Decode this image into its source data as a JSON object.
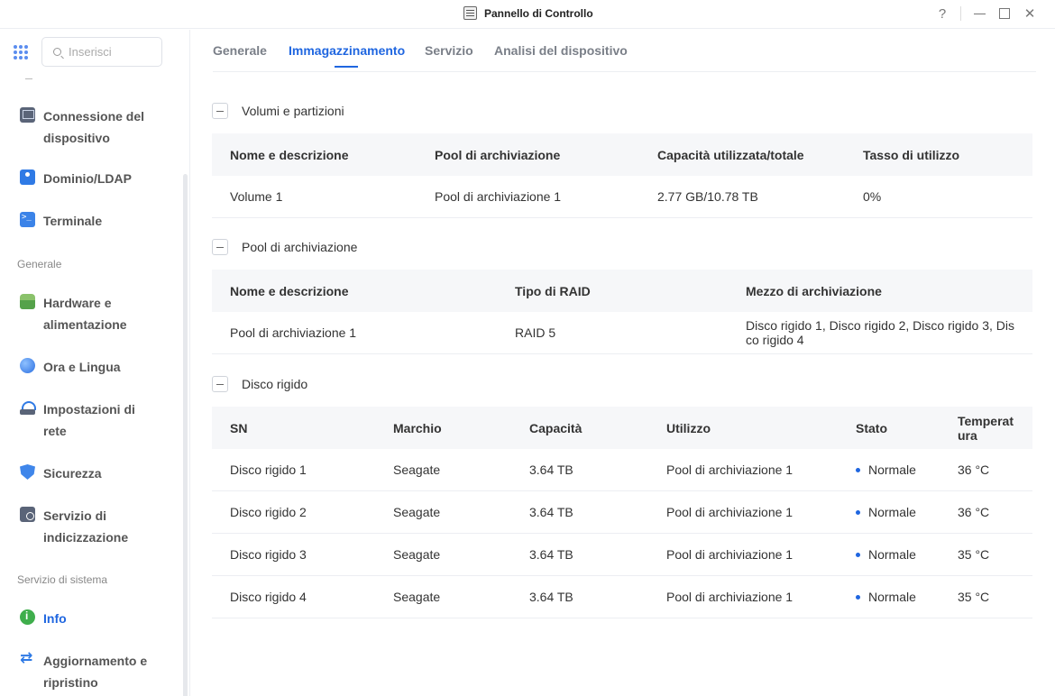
{
  "window": {
    "title": "Pannello di Controllo",
    "help": "?",
    "close": "✕"
  },
  "colors": {
    "accent": "#1f66e0",
    "status_ok": "#1f66e0"
  },
  "sidebar": {
    "search_placeholder": "Inserisci",
    "items": [
      {
        "label": "Connessione del dispositivo",
        "icon": "device-connection-icon"
      },
      {
        "label": "Dominio/LDAP",
        "icon": "domain-ldap-icon"
      },
      {
        "label": "Terminale",
        "icon": "terminal-icon"
      },
      {
        "label": "Hardware e alimentazione",
        "icon": "hardware-power-icon"
      },
      {
        "label": "Ora e Lingua",
        "icon": "time-language-icon"
      },
      {
        "label": "Impostazioni di rete",
        "icon": "network-icon"
      },
      {
        "label": "Sicurezza",
        "icon": "security-shield-icon"
      },
      {
        "label": "Servizio di indicizzazione",
        "icon": "indexing-icon"
      },
      {
        "label": "Info",
        "icon": "info-icon",
        "active": true
      },
      {
        "label": "Aggiornamento e ripristino",
        "icon": "update-restore-icon"
      }
    ],
    "sections": {
      "general": "Generale",
      "system": "Servizio di sistema"
    }
  },
  "tabs": [
    {
      "label": "Generale"
    },
    {
      "label": "Immagazzinamento",
      "active": true
    },
    {
      "label": "Servizio"
    },
    {
      "label": "Analisi del dispositivo"
    }
  ],
  "volumes": {
    "title": "Volumi e partizioni",
    "headers": [
      "Nome e descrizione",
      "Pool di archiviazione",
      "Capacità utilizzata/totale",
      "Tasso di utilizzo"
    ],
    "rows": [
      [
        "Volume 1",
        "Pool di archiviazione 1",
        "2.77 GB/10.78 TB",
        "0%"
      ]
    ]
  },
  "pools": {
    "title": "Pool di archiviazione",
    "headers": [
      "Nome e descrizione",
      "Tipo di RAID",
      "Mezzo di archiviazione"
    ],
    "rows": [
      [
        "Pool di archiviazione 1",
        "RAID 5",
        "Disco rigido 1, Disco rigido 2, Disco rigido 3, Dis co rigido 4"
      ]
    ]
  },
  "disks": {
    "title": "Disco rigido",
    "headers": [
      "SN",
      "Marchio",
      "Capacità",
      "Utilizzo",
      "Stato",
      "Temperat ura"
    ],
    "rows": [
      [
        "Disco rigido 1",
        "Seagate",
        "3.64 TB",
        "Pool di archiviazione 1",
        "Normale",
        "36 °C"
      ],
      [
        "Disco rigido 2",
        "Seagate",
        "3.64 TB",
        "Pool di archiviazione 1",
        "Normale",
        "36 °C"
      ],
      [
        "Disco rigido 3",
        "Seagate",
        "3.64 TB",
        "Pool di archiviazione 1",
        "Normale",
        "35 °C"
      ],
      [
        "Disco rigido 4",
        "Seagate",
        "3.64 TB",
        "Pool di archiviazione 1",
        "Normale",
        "35 °C"
      ]
    ]
  }
}
